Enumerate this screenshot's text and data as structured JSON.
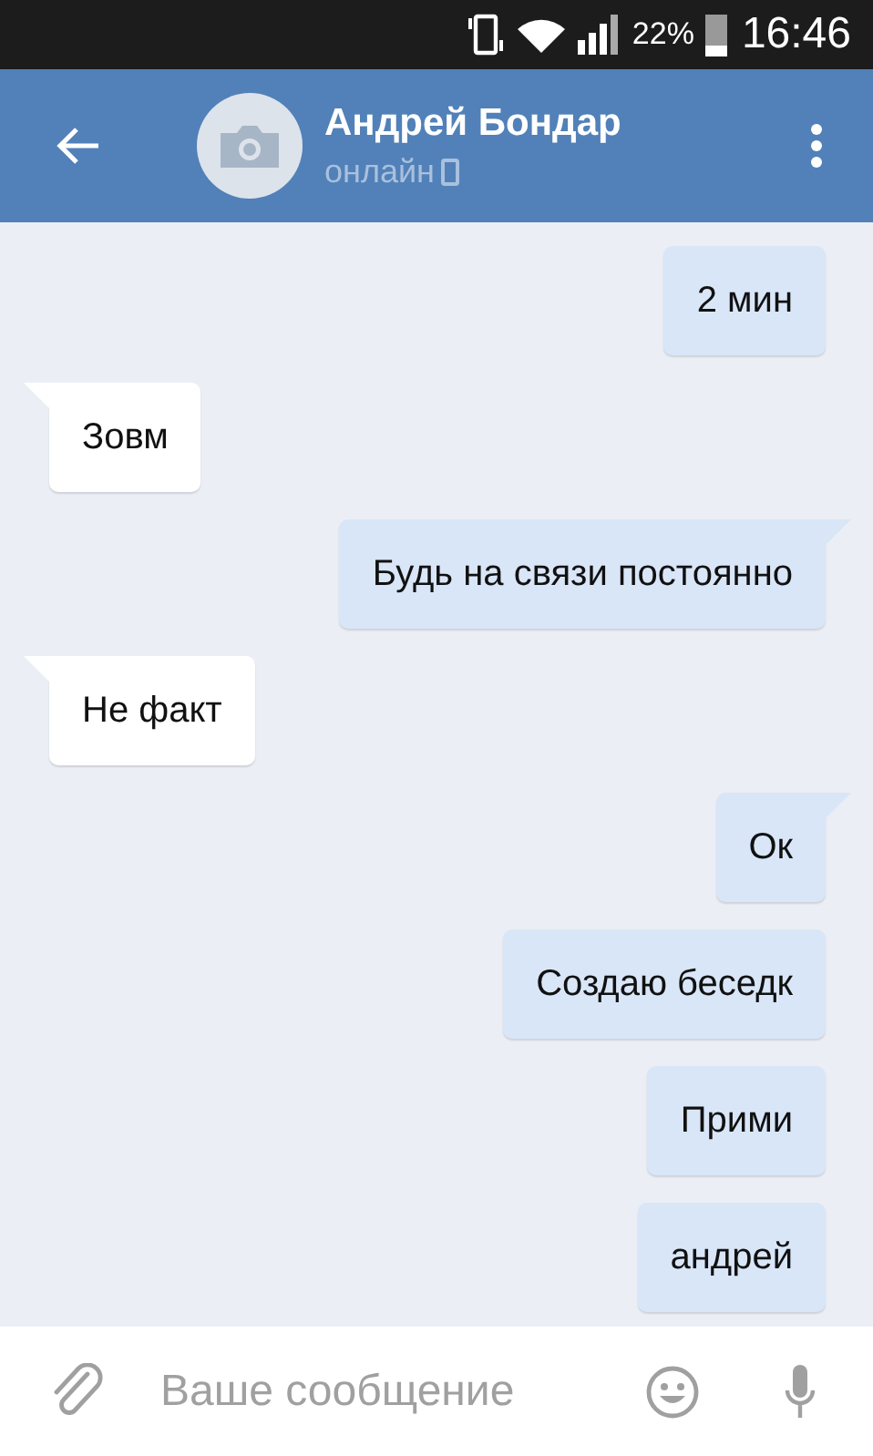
{
  "status_bar": {
    "battery": "22%",
    "time": "16:46"
  },
  "header": {
    "title": "Андрей Бондар",
    "subtitle": "онлайн"
  },
  "messages": [
    {
      "kind": "out",
      "text": "2 мин",
      "tail": false
    },
    {
      "kind": "in",
      "text": "Зовм",
      "tail": true
    },
    {
      "kind": "out",
      "text": "Будь на связи постоянно",
      "tail": true
    },
    {
      "kind": "in",
      "text": "Не факт",
      "tail": true
    },
    {
      "kind": "out",
      "text": "Ок",
      "tail": true
    },
    {
      "kind": "out",
      "text": "Создаю беседк",
      "tail": false
    },
    {
      "kind": "out",
      "text": "Прими",
      "tail": false
    },
    {
      "kind": "out",
      "text": "андрей",
      "tail": false
    }
  ],
  "composer": {
    "placeholder": "Ваше сообщение"
  }
}
